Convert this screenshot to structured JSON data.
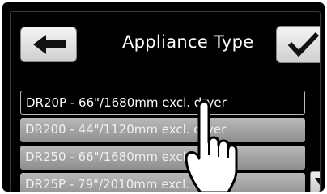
{
  "header": {
    "title": "Appliance Type",
    "back_icon": "arrow-left-icon",
    "confirm_icon": "checkmark-icon"
  },
  "list": {
    "items": [
      {
        "label": "DR20P - 66\"/1680mm excl. dryer",
        "selected": true
      },
      {
        "label": "DR200 - 44\"/1120mm excl. dryer",
        "selected": false
      },
      {
        "label": "DR250 - 66\"/1680mm excl. dryer",
        "selected": false
      },
      {
        "label": "DR25P - 79\"/2010mm excl. dryer",
        "selected": false
      }
    ],
    "scroll_icon": "chevron-down-icon"
  },
  "overlay": {
    "icon": "pointing-hand-icon"
  },
  "colors": {
    "background": "#000000",
    "selected_text": "#ffffff",
    "item_gradient_top": "#b9b9b9",
    "item_gradient_bottom": "#8e8e8e",
    "button_face": "#e6e6e6"
  }
}
